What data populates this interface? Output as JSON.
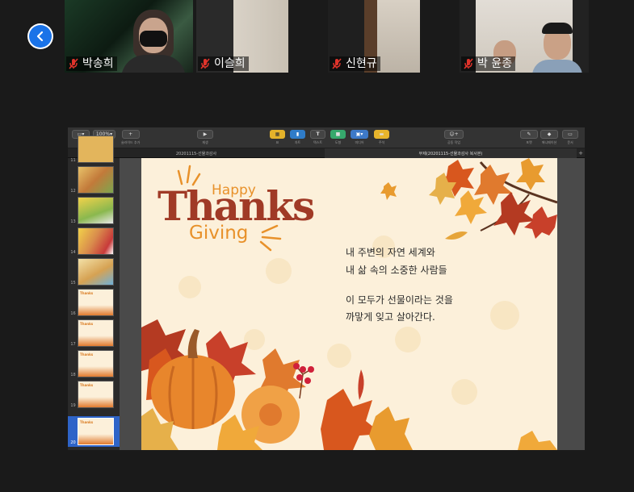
{
  "participants": [
    {
      "name": "박송희",
      "muted": true
    },
    {
      "name": "이슬희",
      "muted": true
    },
    {
      "name": "신현규",
      "muted": true
    },
    {
      "name": "박 윤종",
      "muted": true
    }
  ],
  "toolbar": {
    "view": "보기",
    "zoom_value": "100%",
    "zoom": "확대/축소",
    "add_slide": "슬라이드 추가",
    "play": "재생",
    "table": "표",
    "chart": "차트",
    "text": "텍스트",
    "shape": "도형",
    "media": "미디어",
    "comment": "주석",
    "collaborate": "공동 작업",
    "format": "포맷",
    "animate": "애니메이션",
    "document": "문서"
  },
  "tabs": [
    {
      "label": "20201115-선물과감사",
      "active": false
    },
    {
      "label": "무제(20201115-선물과감사 복사본)",
      "active": true
    }
  ],
  "slide_numbers": [
    "11",
    "12",
    "13",
    "14",
    "15",
    "16",
    "17",
    "18",
    "19",
    "20"
  ],
  "thumb_title": "Thanks",
  "slide": {
    "happy": "Happy",
    "thanks": "Thanks",
    "giving": "Giving",
    "line1": "내 주변의 자연 세계와",
    "line2": "내 삶 속의 소중한 사람들",
    "line3": "이 모두가 선물이라는 것을",
    "line4": "까맣게 잊고 살아간다."
  },
  "colors": {
    "accent": "#1a73e8",
    "thanks": "#a03a26",
    "happy": "#e8912a",
    "slide_bg": "#fcf0da",
    "muted_icon": "#e0332b"
  }
}
